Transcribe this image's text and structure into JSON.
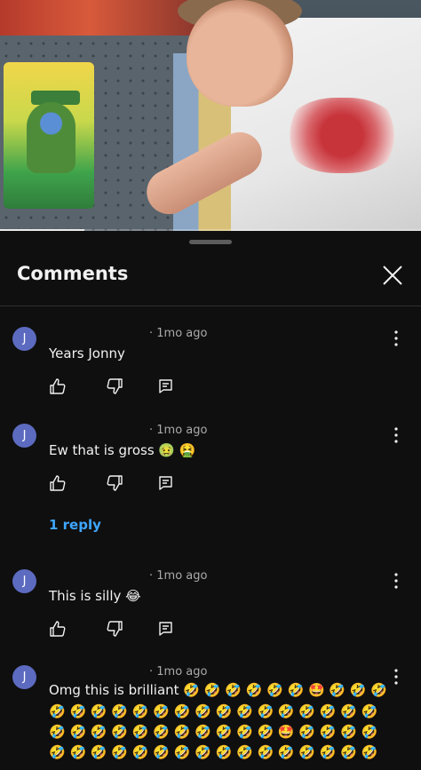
{
  "video": {
    "progress_fraction": 0.2
  },
  "sheet": {
    "title": "Comments"
  },
  "comments": [
    {
      "avatar_initial": "J",
      "meta": "· 1mo ago",
      "text": "Years Jonny"
    },
    {
      "avatar_initial": "J",
      "meta": "· 1mo ago",
      "text": "Ew that is gross 🤢 🤮",
      "reply_link": "1 reply"
    },
    {
      "avatar_initial": "J",
      "meta": "· 1mo ago",
      "text": "This is silly 😂"
    },
    {
      "avatar_initial": "J",
      "meta": "· 1mo ago",
      "text": "Omg this is brilliant 🤣 🤣 🤣 🤣 🤣 🤣 🤩 🤣 🤣 🤣",
      "continuation_lines": [
        "🤣 🤣 🤣 🤣 🤣 🤣 🤣 🤣 🤣 🤣 🤣 🤣 🤣 🤣 🤣 🤣",
        "🤣 🤣 🤣 🤣 🤣 🤣 🤣 🤣 🤣 🤣 🤣 🤩 🤣 🤣 🤣 🤣",
        "🤣 🤣 🤣 🤣 🤣 🤣 🤣 🤣 🤣 🤣 🤣 🤣 🤣 🤣 🤣 🤣"
      ]
    }
  ],
  "icons": {
    "close": "close-icon",
    "more": "more-vertical-icon",
    "like": "thumbs-up-icon",
    "dislike": "thumbs-down-icon",
    "reply": "reply-icon"
  },
  "colors": {
    "background": "#0f0f0f",
    "avatar": "#5c6bc0",
    "link": "#3ea6ff",
    "secondary_text": "#aaaaaa"
  }
}
